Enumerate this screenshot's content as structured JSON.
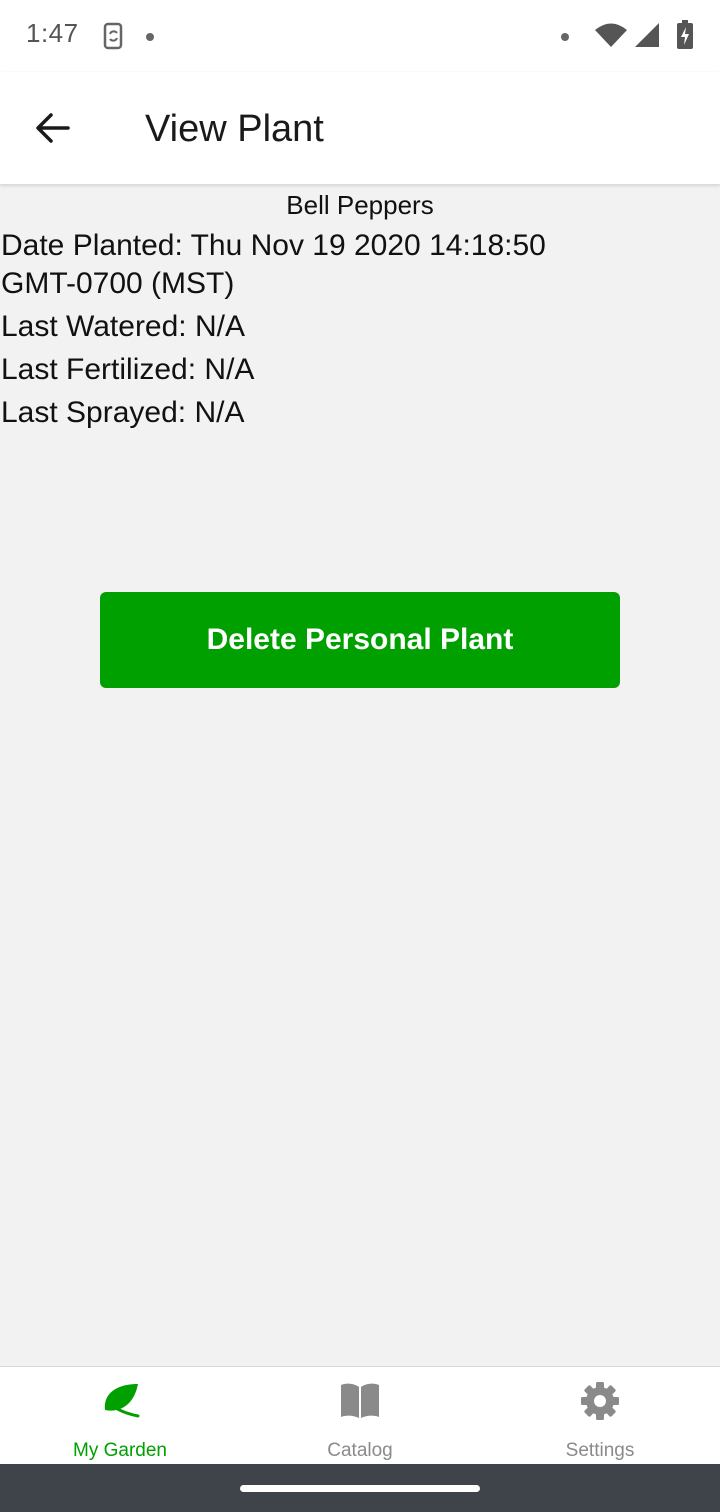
{
  "status_bar": {
    "time": "1:47",
    "icons": [
      "sync-icon",
      "notification-dot-icon",
      "dot-icon",
      "wifi-icon",
      "cellular-signal-icon",
      "battery-charging-icon"
    ]
  },
  "app_bar": {
    "back_icon": "arrow-left-icon",
    "title": "View Plant"
  },
  "plant": {
    "name": "Bell Peppers",
    "date_planted_line1": "Date Planted: Thu Nov 19 2020 14:18:50",
    "date_planted_line2": "GMT-0700 (MST)",
    "last_watered": "Last Watered: N/A",
    "last_fertilized": "Last Fertilized: N/A",
    "last_sprayed": "Last Sprayed: N/A"
  },
  "actions": {
    "delete_label": "Delete Personal Plant"
  },
  "bottom_nav": {
    "items": [
      {
        "label": "My Garden",
        "icon": "leaf-icon",
        "active": true
      },
      {
        "label": "Catalog",
        "icon": "book-icon",
        "active": false
      },
      {
        "label": "Settings",
        "icon": "gear-icon",
        "active": false
      }
    ]
  },
  "colors": {
    "accent": "#00a000",
    "background": "#f2f2f2",
    "inactive": "#8a8a8a"
  }
}
